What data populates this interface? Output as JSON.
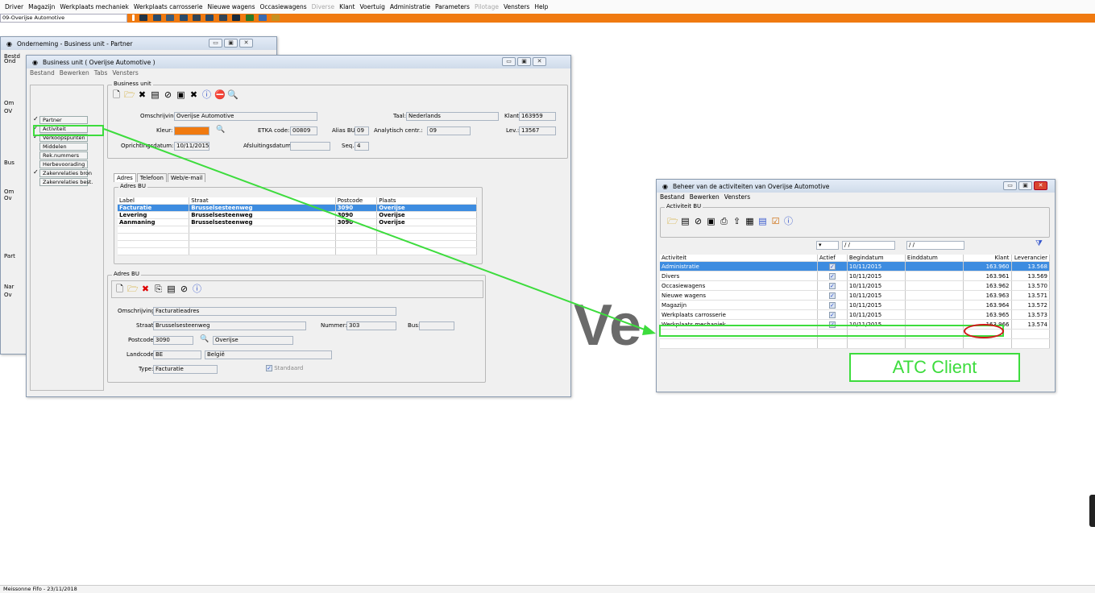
{
  "menu": [
    "Driver",
    "Magazijn",
    "Werkplaats mechaniek",
    "Werkplaats carrosserie",
    "Nieuwe wagens",
    "Occasiewagens",
    "Diverse",
    "Klant",
    "Voertuig",
    "Administratie",
    "Parameters",
    "Pilotage",
    "Vensters",
    "Help"
  ],
  "bu_selector": "09-Overijse Automotive",
  "partner_window": {
    "title": "Onderneming - Business unit - Partner",
    "side_labels": [
      "Bestd",
      "Ond",
      "Om",
      "OV",
      "Bus",
      "Om",
      "Ov",
      "Part",
      "Nar",
      "Ov"
    ]
  },
  "bu_window": {
    "title": "Business unit  ( Overijse Automotive )",
    "menu": [
      "Bestand",
      "Bewerken",
      "Tabs",
      "Vensters"
    ],
    "group_label": "Business unit",
    "nav": [
      {
        "label": "Partner",
        "checked": true
      },
      {
        "label": "Activiteit",
        "checked": true
      },
      {
        "label": "Verkoopspunten",
        "checked": true
      },
      {
        "label": "Middelen",
        "checked": false
      },
      {
        "label": "Rek.nummers",
        "checked": false
      },
      {
        "label": "Herbevoorading",
        "checked": false
      },
      {
        "label": "Zakenrelaties bron",
        "checked": true
      },
      {
        "label": "Zakenrelaties best.",
        "checked": false
      }
    ],
    "fields": {
      "omschrijving_label": "Omschrijving:",
      "omschrijving": "Overijse Automotive",
      "taal_label": "Taal:",
      "taal": "Nederlands",
      "klant_label": "Klant:",
      "klant": "163959",
      "kleur_label": "Kleur:",
      "etka_label": "ETKA code:",
      "etka": "00809",
      "alias_label": "Alias BU:",
      "alias": "09",
      "analytisch_label": "Analytisch centr.:",
      "analytisch": "09",
      "lev_label": "Lev.:",
      "lev": "13567",
      "oprichting_label": "Oprichtingsdatum:",
      "oprichting": "10/11/2015",
      "afsluiting_label": "Afsluitingsdatum:",
      "seq_label": "Seq.:",
      "seq": "4"
    },
    "tabs": [
      "Adres",
      "Telefoon",
      "Web/e-mail"
    ],
    "adres_group": "Adres BU",
    "adres_headers": [
      "Label",
      "Straat",
      "Postcode",
      "Plaats"
    ],
    "adres_rows": [
      [
        "Facturatie",
        "Brusselsesteenweg",
        "3090",
        "Overijse"
      ],
      [
        "Levering",
        "Brusselsesteenweg",
        "3090",
        "Overijse"
      ],
      [
        "Aanmaning",
        "Brusselsesteenweg",
        "3090",
        "Overijse"
      ]
    ],
    "detail_group": "Adres BU",
    "detail": {
      "omschrijving_label": "Omschrijving:",
      "omschrijving": "Facturatieadres",
      "straat_label": "Straat:",
      "straat": "Brusselsesteenweg",
      "nummer_label": "Nummer:",
      "nummer": "303",
      "bus_label": "Bus:",
      "postcode_label": "Postcode:",
      "postcode": "3090",
      "gemeente": "Overijse",
      "landcode_label": "Landcode:",
      "landcode": "BE",
      "land": "België",
      "type_label": "Type:",
      "type": "Facturatie",
      "standaard": "Standaard"
    }
  },
  "act_window": {
    "title": "Beheer van de activiteiten van Overijse Automotive",
    "menu": [
      "Bestand",
      "Bewerken",
      "Vensters"
    ],
    "group_label": "Activiteit BU",
    "filter_date1": "/ /",
    "filter_date2": "/ /",
    "headers": [
      "Activiteit",
      "Actief",
      "Begindatum",
      "Einddatum",
      "Klant",
      "Leverancier"
    ],
    "rows": [
      [
        "Administratie",
        "10/11/2015",
        "",
        "163.960",
        "13.568"
      ],
      [
        "Divers",
        "10/11/2015",
        "",
        "163.961",
        "13.569"
      ],
      [
        "Occasiewagens",
        "10/11/2015",
        "",
        "163.962",
        "13.570"
      ],
      [
        "Nieuwe wagens",
        "10/11/2015",
        "",
        "163.963",
        "13.571"
      ],
      [
        "Magazijn",
        "10/11/2015",
        "",
        "163.964",
        "13.572"
      ],
      [
        "Werkplaats carrosserie",
        "10/11/2015",
        "",
        "163.965",
        "13.573"
      ],
      [
        "Werkplaats mechaniek",
        "10/11/2015",
        "",
        "163.966",
        "13.574"
      ]
    ]
  },
  "watermark": "Ve",
  "annotation": "ATC Client",
  "status": "Meissonne  Fifo - 23/11/2018",
  "colors": {
    "accent_orange": "#f07a10",
    "highlight_green": "#3ddc3d",
    "selection_blue": "#3d8ce0",
    "circle_red": "#d01818"
  }
}
